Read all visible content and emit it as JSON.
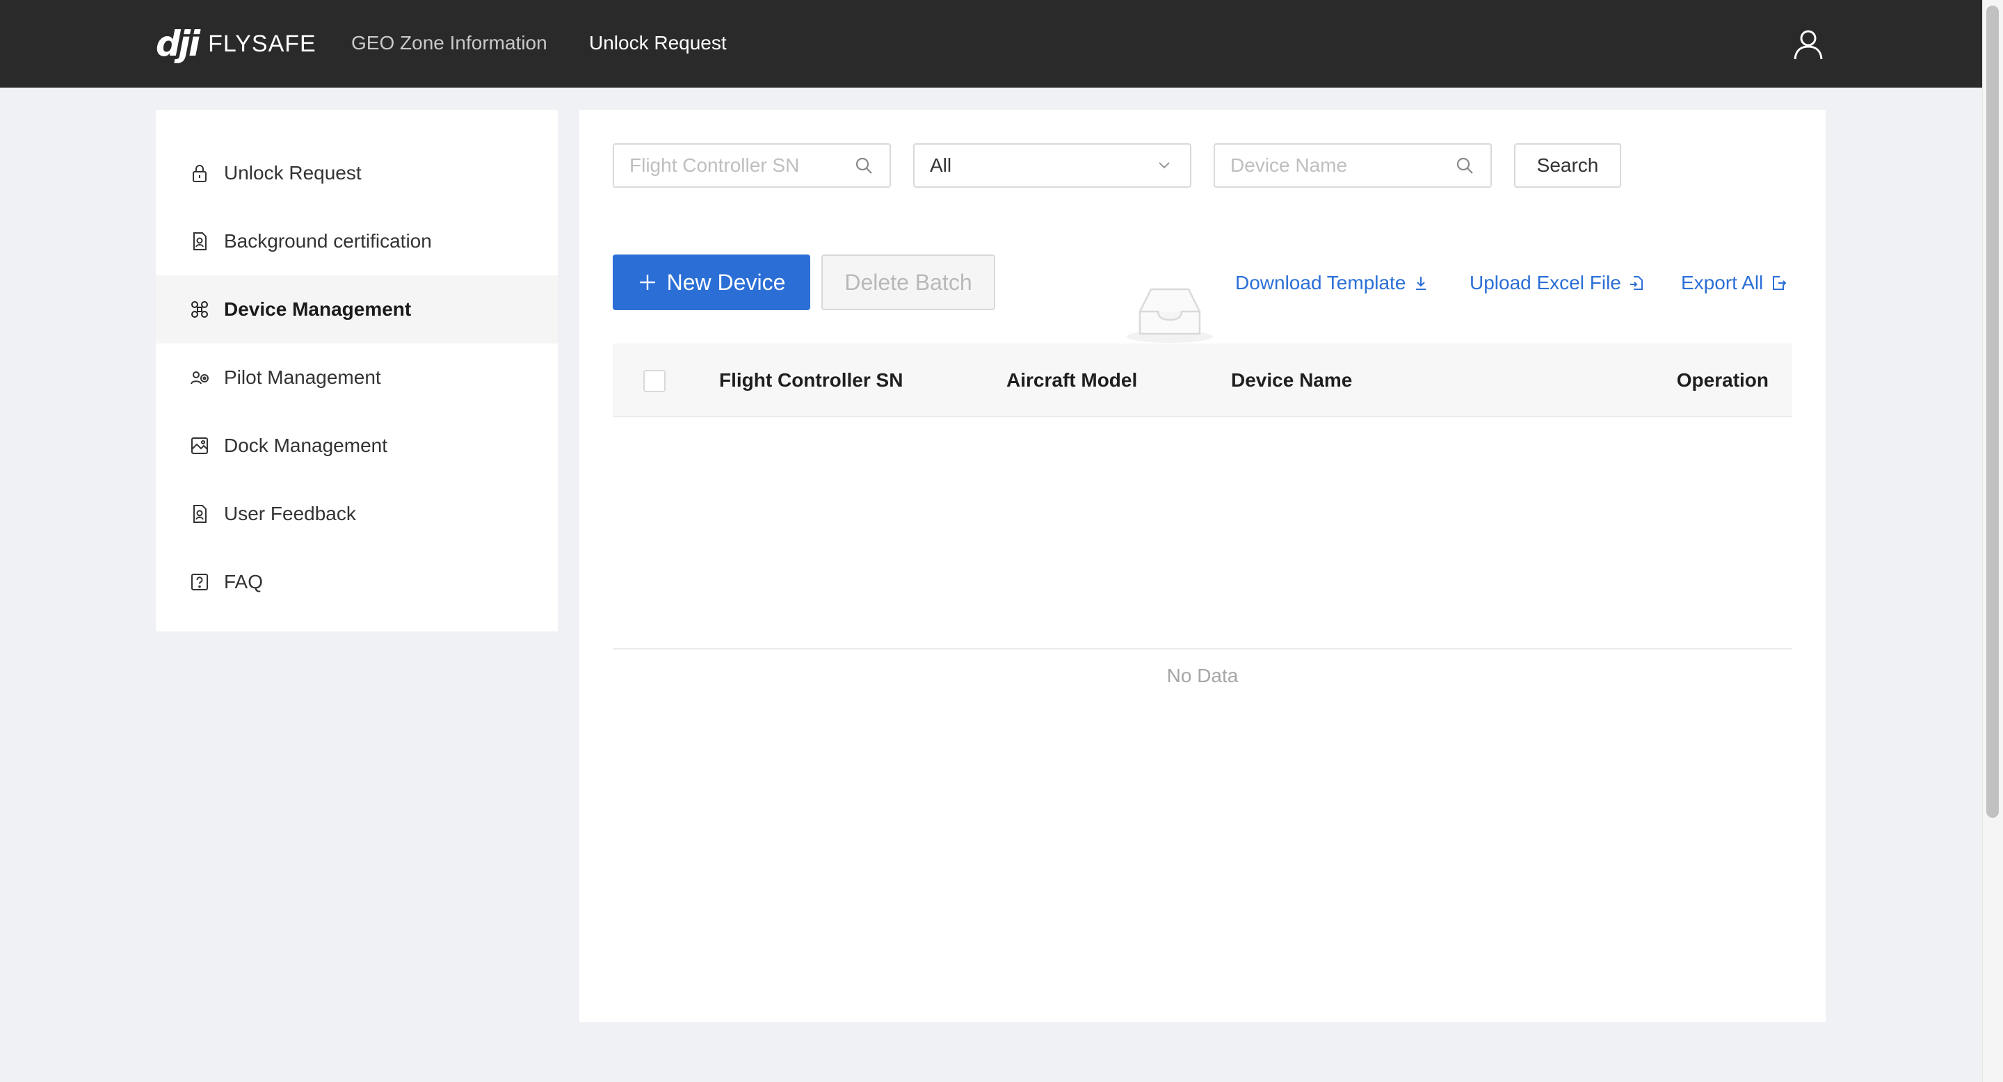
{
  "header": {
    "logo_mark": "dji",
    "logo_text": "FLYSAFE",
    "nav": [
      {
        "label": "GEO Zone Information",
        "active": false
      },
      {
        "label": "Unlock Request",
        "active": true
      }
    ],
    "user_icon": "user-icon"
  },
  "sidebar": {
    "items": [
      {
        "label": "Unlock Request",
        "icon": "lock-icon",
        "active": false
      },
      {
        "label": "Background certification",
        "icon": "certificate-icon",
        "active": false
      },
      {
        "label": "Device Management",
        "icon": "drone-icon",
        "active": true
      },
      {
        "label": "Pilot Management",
        "icon": "pilot-icon",
        "active": false
      },
      {
        "label": "Dock Management",
        "icon": "dock-icon",
        "active": false
      },
      {
        "label": "User Feedback",
        "icon": "feedback-icon",
        "active": false
      },
      {
        "label": "FAQ",
        "icon": "help-icon",
        "active": false
      }
    ]
  },
  "filters": {
    "sn_placeholder": "Flight Controller SN",
    "model_select_value": "All",
    "name_placeholder": "Device Name",
    "search_label": "Search"
  },
  "actions": {
    "new_device_label": "New Device",
    "delete_batch_label": "Delete Batch",
    "download_template_label": "Download Template",
    "upload_excel_label": "Upload Excel File",
    "export_all_label": "Export All"
  },
  "table": {
    "columns": [
      "Flight Controller SN",
      "Aircraft Model",
      "Device Name",
      "Operation"
    ],
    "rows": [],
    "empty_text": "No Data"
  },
  "colors": {
    "header_bg": "#2a2a2a",
    "primary": "#2b6fd6",
    "page_bg": "#f0f1f5"
  }
}
